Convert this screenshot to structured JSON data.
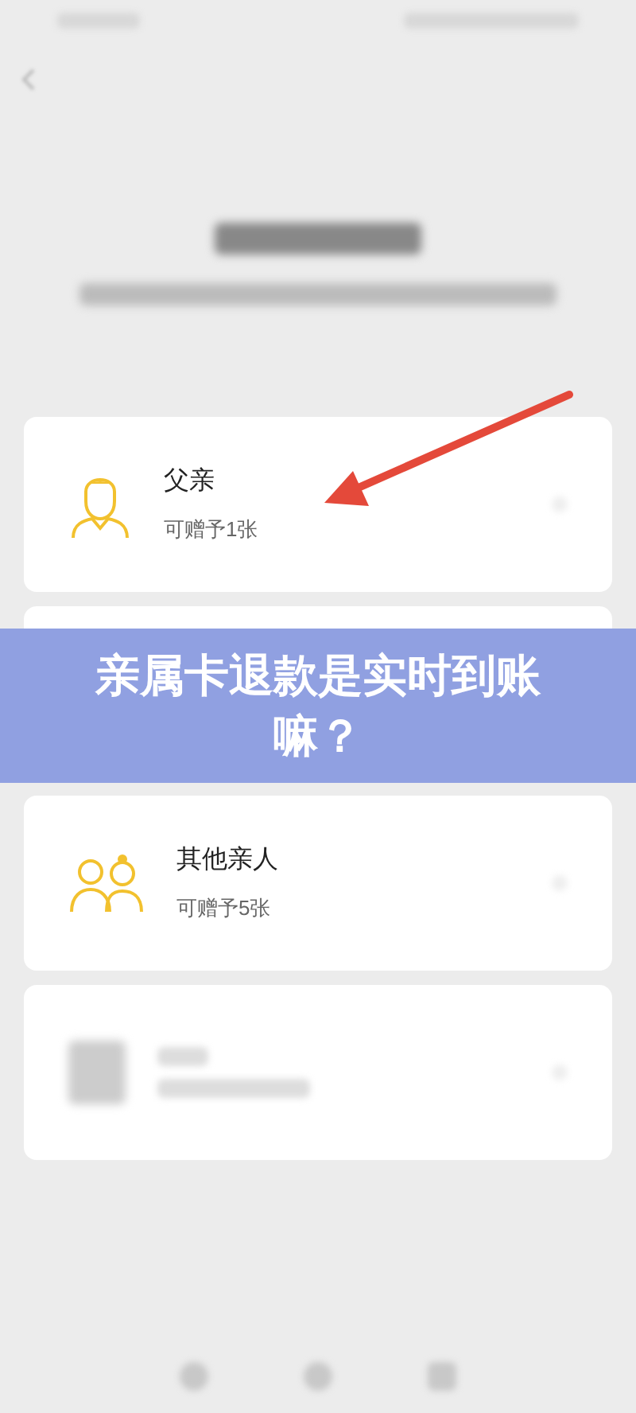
{
  "cards": [
    {
      "kind": "father",
      "name": "父亲",
      "quota": "可赠予1张"
    },
    {
      "kind": "covered"
    },
    {
      "kind": "relatives",
      "name": "其他亲人",
      "quota": "可赠予5张"
    },
    {
      "kind": "blurred"
    }
  ],
  "banner": {
    "title": "亲属卡退款是实时到账嘛？"
  }
}
